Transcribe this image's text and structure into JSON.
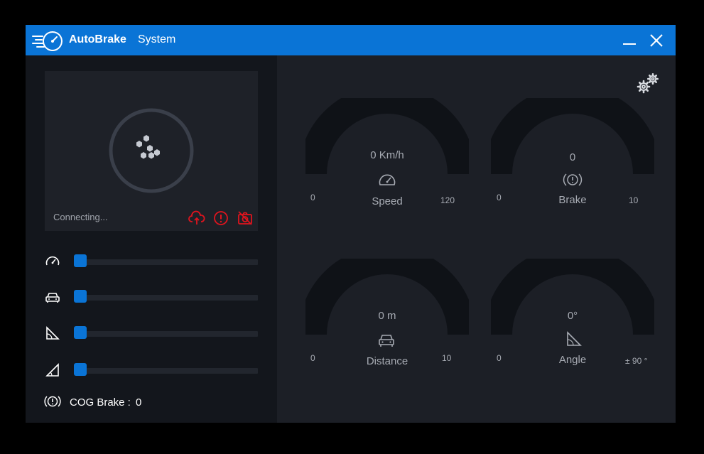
{
  "app": {
    "name": "AutoBrake",
    "subtitle": "System"
  },
  "colors": {
    "accent": "#0a74d6",
    "alert": "#e0141e",
    "panel": "#13161c",
    "background": "#1c1f26"
  },
  "camera": {
    "status": "Connecting...",
    "status_icons": [
      "cloud-upload-alert-icon",
      "alert-circle-icon",
      "camera-off-icon"
    ]
  },
  "sliders": [
    {
      "icon": "speedometer-icon",
      "value": 0
    },
    {
      "icon": "car-icon",
      "value": 0
    },
    {
      "icon": "distance-icon",
      "value": 0
    },
    {
      "icon": "angle-icon",
      "value": 0
    }
  ],
  "cog_brake": {
    "label": "COG Brake :",
    "value": "0"
  },
  "gauges": {
    "speed": {
      "value": "0 Km/h",
      "label": "Speed",
      "min": "0",
      "max": "120",
      "icon": "speedometer-icon"
    },
    "brake": {
      "value": "0",
      "label": "Brake",
      "min": "0",
      "max": "10",
      "icon": "brake-icon"
    },
    "distance": {
      "value": "0 m",
      "label": "Distance",
      "min": "0",
      "max": "10",
      "icon": "car-icon"
    },
    "angle": {
      "value": "0°",
      "label": "Angle",
      "min": "0",
      "max": "± 90 °",
      "icon": "angle-icon"
    }
  }
}
